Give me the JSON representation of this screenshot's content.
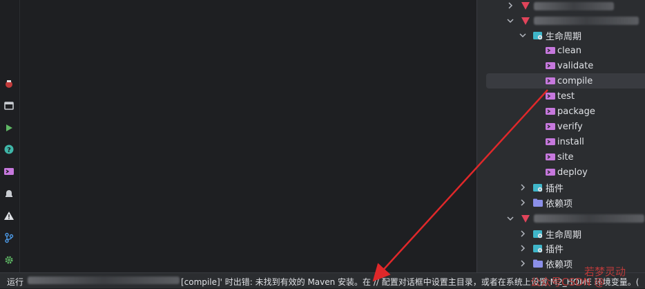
{
  "status_bar": {
    "prefix": "运行",
    "middle": "[compile]' 时出错: 未找到有效的 Maven 安装。在 // 配置对话框中设置主目录，或者在系统上设置 M2_HOME 环境变量。(",
    "tail": "(..."
  },
  "maven_panel": {
    "lifecycle_label": "生命周期",
    "goals": [
      "clean",
      "validate",
      "compile",
      "test",
      "package",
      "verify",
      "install",
      "site",
      "deploy"
    ],
    "selected_goal": "compile",
    "plugins_label": "插件",
    "dependencies_label": "依赖项",
    "module2_lifecycle_label": "生命周期",
    "module2_plugins_label": "插件",
    "module2_dependencies_label": "依赖项"
  },
  "watermark": {
    "text_1": "公众号CSDN @",
    "text_2": "若梦灵动"
  },
  "colors": {
    "background": "#1e1f22",
    "panel": "#2b2d30",
    "selection": "#393b40",
    "arrow": "#e0282a",
    "goal_icon": "#c678dd",
    "lifecycle_icon": "#3fb6c9",
    "module_icon": "#e0445a"
  }
}
